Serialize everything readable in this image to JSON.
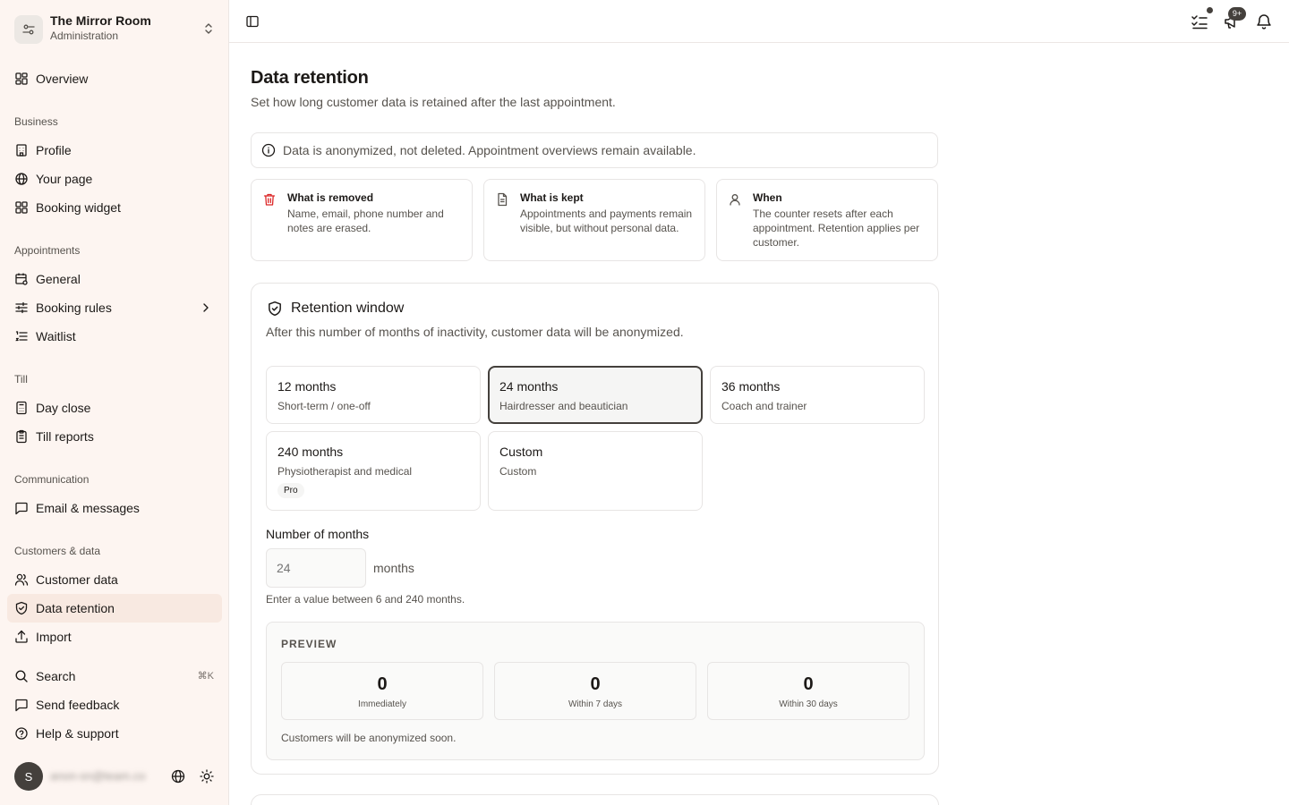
{
  "brand": {
    "name": "The Mirror Room",
    "subtitle": "Administration"
  },
  "sidebar": {
    "overview": "Overview",
    "groups": {
      "business": "Business",
      "appointments": "Appointments",
      "till": "Till",
      "communication": "Communication",
      "customers": "Customers & data"
    },
    "items": {
      "profile": "Profile",
      "your_page": "Your page",
      "booking_widget": "Booking widget",
      "general": "General",
      "booking_rules": "Booking rules",
      "waitlist": "Waitlist",
      "day_close": "Day close",
      "till_reports": "Till reports",
      "email_messages": "Email & messages",
      "customer_data": "Customer data",
      "data_retention": "Data retention",
      "import": "Import",
      "search": "Search",
      "search_shortcut": "⌘K",
      "send_feedback": "Send feedback",
      "help_support": "Help & support"
    },
    "active": "data_retention",
    "user": {
      "initial": "S",
      "email": "anon-sn@team.co"
    }
  },
  "topbar": {
    "messages_badge": "9+"
  },
  "page": {
    "title": "Data retention",
    "subtitle": "Set how long customer data is retained after the last appointment.",
    "notice": "Data is anonymized, not deleted. Appointment overviews remain available."
  },
  "info_cards": [
    {
      "title": "What is removed",
      "description": "Name, email, phone number and notes are erased.",
      "icon": "trash-icon",
      "icon_color": "#dc2626"
    },
    {
      "title": "What is kept",
      "description": "Appointments and payments remain visible, but without personal data.",
      "icon": "file-icon"
    },
    {
      "title": "When",
      "description": "The counter resets after each appointment. Retention applies per customer.",
      "icon": "user-icon"
    }
  ],
  "retention": {
    "title": "Retention window",
    "subtitle": "After this number of months of inactivity, customer data will be anonymized.",
    "options": [
      {
        "title": "12 months",
        "subtitle": "Short-term / one-off"
      },
      {
        "title": "24 months",
        "subtitle": "Hairdresser and beautician",
        "selected": true
      },
      {
        "title": "36 months",
        "subtitle": "Coach and trainer"
      },
      {
        "title": "240 months",
        "subtitle": "Physiotherapist and medical",
        "badge": "Pro"
      },
      {
        "title": "Custom",
        "subtitle": "Custom"
      }
    ],
    "months_label": "Number of months",
    "months_placeholder": "24",
    "months_unit": "months",
    "months_hint": "Enter a value between 6 and 240 months."
  },
  "preview": {
    "label": "PREVIEW",
    "stats": [
      {
        "value": "0",
        "label": "Immediately"
      },
      {
        "value": "0",
        "label": "Within 7 days"
      },
      {
        "value": "0",
        "label": "Within 30 days"
      }
    ],
    "note": "Customers will be anonymized soon."
  },
  "colors": {
    "sidebar_bg": "#fdf5f1",
    "active_bg": "#f8e9e1",
    "selected_border": "#44403c"
  }
}
